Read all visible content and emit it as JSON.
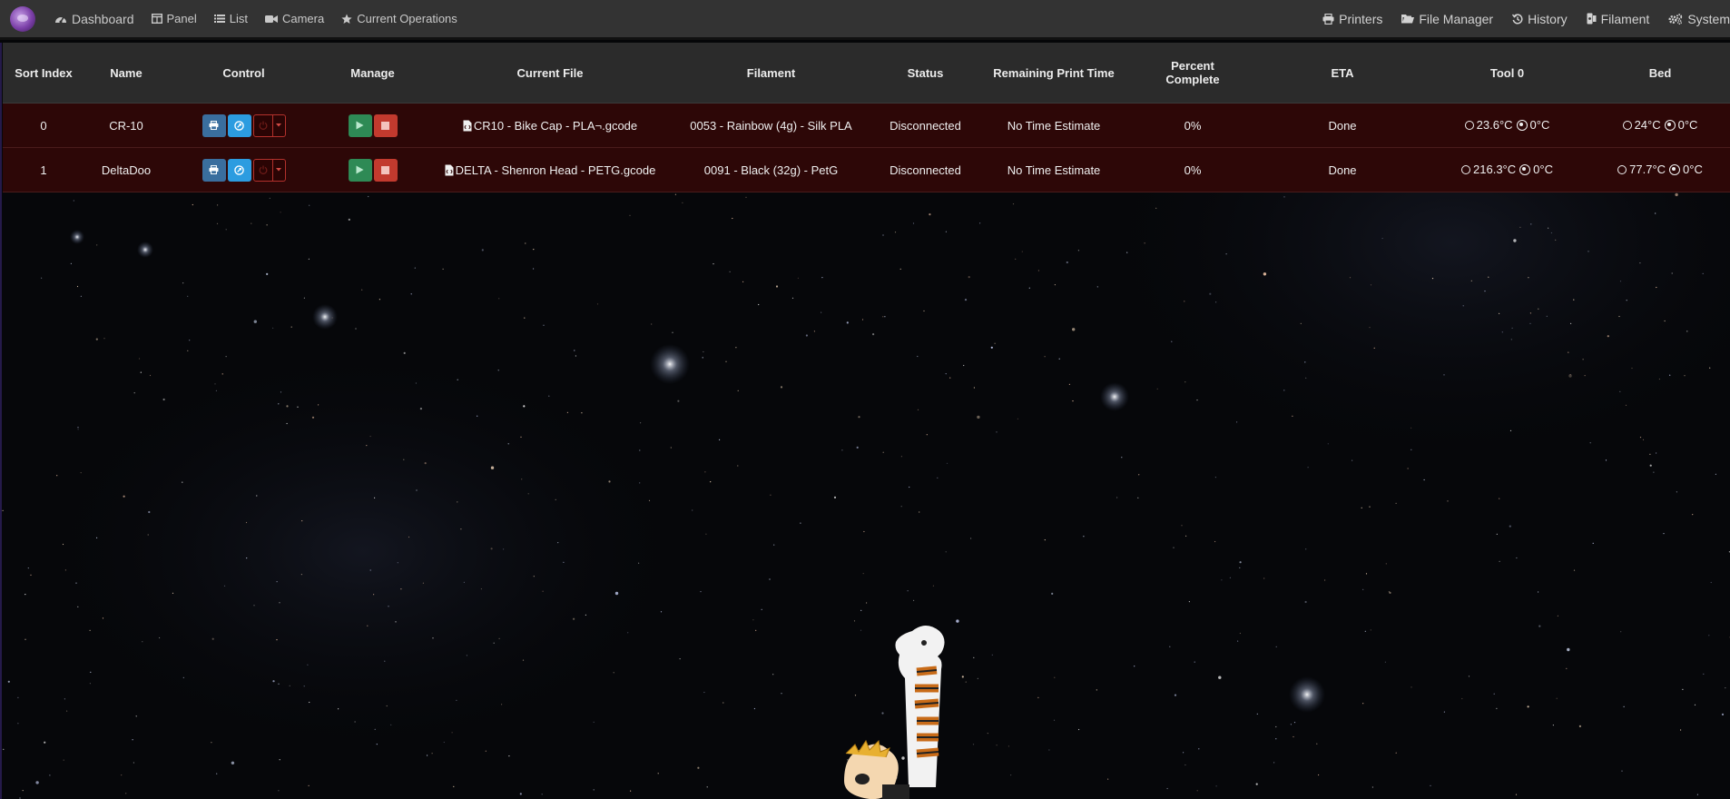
{
  "nav": {
    "left": [
      {
        "label": "Dashboard",
        "icon": "dashboard-icon"
      },
      {
        "label": "Panel",
        "icon": "panel-icon"
      },
      {
        "label": "List",
        "icon": "list-icon"
      },
      {
        "label": "Camera",
        "icon": "camera-icon"
      },
      {
        "label": "Current Operations",
        "icon": "star-icon"
      }
    ],
    "right": [
      {
        "label": "Printers",
        "icon": "printer-icon"
      },
      {
        "label": "File Manager",
        "icon": "folder-icon"
      },
      {
        "label": "History",
        "icon": "history-icon"
      },
      {
        "label": "Filament",
        "icon": "filament-icon"
      },
      {
        "label": "System",
        "icon": "gears-icon"
      }
    ]
  },
  "table": {
    "headers": {
      "sort_index": "Sort Index",
      "name": "Name",
      "control": "Control",
      "manage": "Manage",
      "current_file": "Current File",
      "filament": "Filament",
      "status": "Status",
      "remaining": "Remaining Print Time",
      "percent_line1": "Percent",
      "percent_line2": "Complete",
      "eta": "ETA",
      "tool0": "Tool 0",
      "bed": "Bed"
    },
    "rows": [
      {
        "sort_index": "0",
        "name": "CR-10",
        "current_file": "CR10 - Bike Cap - PLA¬.gcode",
        "filament": "0053 - Rainbow (4g) - Silk PLA",
        "status": "Disconnected",
        "remaining": "No Time Estimate",
        "percent": "0%",
        "eta": "Done",
        "tool0_actual": "23.6°C",
        "tool0_target": "0°C",
        "bed_actual": "24°C",
        "bed_target": "0°C"
      },
      {
        "sort_index": "1",
        "name": "DeltaDoo",
        "current_file": "DELTA - Shenron Head - PETG.gcode",
        "filament": "0091 - Black (32g) - PetG",
        "status": "Disconnected",
        "remaining": "No Time Estimate",
        "percent": "0%",
        "eta": "Done",
        "tool0_actual": "216.3°C",
        "tool0_target": "0°C",
        "bed_actual": "77.7°C",
        "bed_target": "0°C"
      }
    ]
  },
  "colors": {
    "navbar": "#333333",
    "row_background": "#2d0707",
    "print_button": "#3a6e9e",
    "connect_button": "#2c9ce0",
    "start_button": "#2e8a55",
    "stop_button": "#c23a2e",
    "power_outline": "#b3312c"
  }
}
